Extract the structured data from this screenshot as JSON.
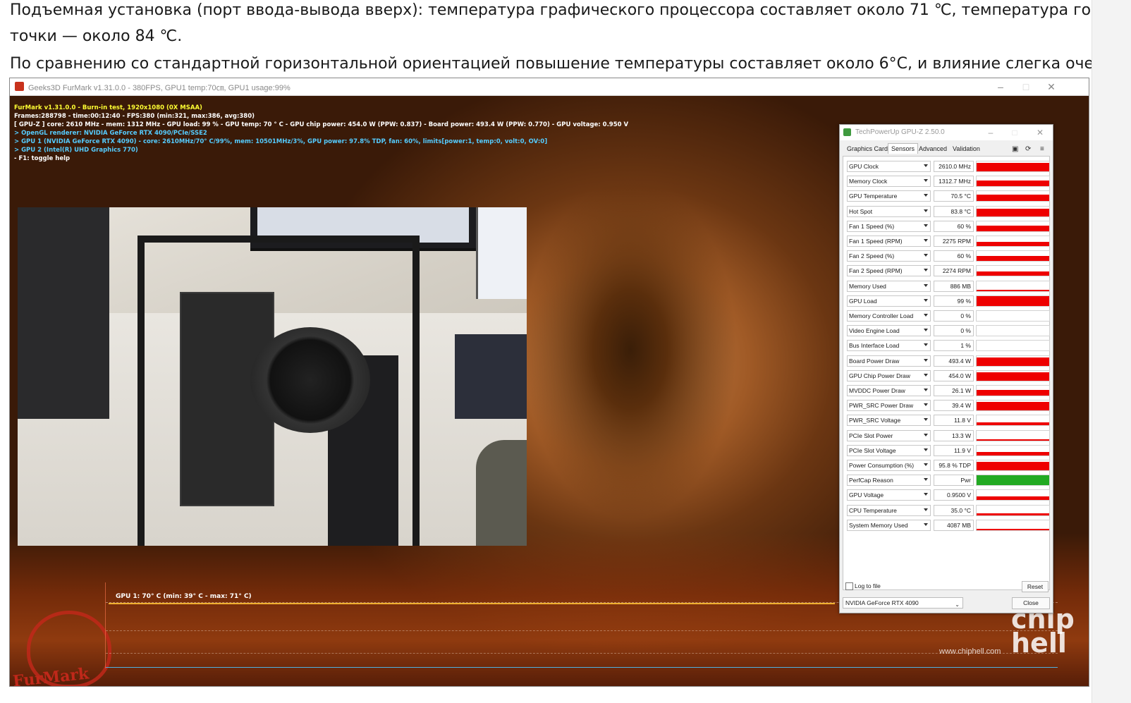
{
  "article": {
    "line1": "Подъемная установка (порт ввода-вывода вверх): температура графического процессора составляет около 71 ℃, температура горячей",
    "line2": "точки — около 84 ℃.",
    "line3": "По сравнению со стандартной горизонтальной ориентацией повышение температуры составляет около 6°C, и влияние слегка очевидно."
  },
  "furmark": {
    "window_title": "Geeks3D FurMark v1.31.0.0 - 380FPS, GPU1 temp:70㎝, GPU1 usage:99%",
    "overlay": [
      {
        "text": "FurMark v1.31.0.0 - Burn-in test, 1920x1080 (0X MSAA)",
        "color": "#ffff33"
      },
      {
        "text": "Frames:288798 - time:00:12:40 - FPS:380 (min:321, max:386, avg:380)",
        "color": "#ffffff"
      },
      {
        "text": "[ GPU-Z ] core: 2610 MHz - mem: 1312 MHz - GPU load: 99 % - GPU temp: 70 ° C - GPU chip power: 454.0 W (PPW: 0.837) - Board power: 493.4 W (PPW: 0.770) - GPU voltage: 0.950 V",
        "color": "#ffffff"
      },
      {
        "text": "> OpenGL renderer: NVIDIA GeForce RTX 4090/PCIe/SSE2",
        "color": "#55ccff"
      },
      {
        "text": "> GPU 1 (NVIDIA GeForce RTX 4090) - core: 2610MHz/70° C/99%, mem: 10501MHz/3%, GPU power: 97.8% TDP, fan: 60%, limits[power:1, temp:0, volt:0, OV:0]",
        "color": "#55ccff"
      },
      {
        "text": "> GPU 2 (Intel(R) UHD Graphics 770)",
        "color": "#55ccff"
      },
      {
        "text": "- F1: toggle help",
        "color": "#ffffff"
      }
    ],
    "graph_label": "GPU 1: 70° C (min: 39° C - max: 71° C)",
    "logo_text": "FurMark",
    "watermark_logo": "chip hell",
    "watermark_url": "www.chiphell.com",
    "colors": {
      "overlay_title": "#ffff33",
      "graph_line": "#f0b030",
      "graph_base": "#4fb0e0"
    }
  },
  "gpuz": {
    "title": "TechPowerUp GPU-Z 2.50.0",
    "tabs": [
      "Graphics Card",
      "Sensors",
      "Advanced",
      "Validation"
    ],
    "active_tab": "Sensors",
    "toolbar_icons": [
      "camera-icon",
      "refresh-icon",
      "menu-icon"
    ],
    "sensors": [
      {
        "name": "GPU Clock",
        "value": "2610.0 MHz",
        "level": 0.85,
        "graph": "red"
      },
      {
        "name": "Memory Clock",
        "value": "1312.7 MHz",
        "level": 0.6,
        "graph": "red"
      },
      {
        "name": "GPU Temperature",
        "value": "70.5 °C",
        "level": 0.7,
        "graph": "red"
      },
      {
        "name": "Hot Spot",
        "value": "83.8 °C",
        "level": 0.75,
        "graph": "red"
      },
      {
        "name": "Fan 1 Speed (%)",
        "value": "60 %",
        "level": 0.55,
        "graph": "red"
      },
      {
        "name": "Fan 1 Speed (RPM)",
        "value": "2275 RPM",
        "level": 0.45,
        "graph": "red"
      },
      {
        "name": "Fan 2 Speed (%)",
        "value": "60 %",
        "level": 0.55,
        "graph": "red"
      },
      {
        "name": "Fan 2 Speed (RPM)",
        "value": "2274 RPM",
        "level": 0.45,
        "graph": "red"
      },
      {
        "name": "Memory Used",
        "value": "886 MB",
        "level": 0.08,
        "graph": "red"
      },
      {
        "name": "GPU Load",
        "value": "99 %",
        "level": 0.99,
        "graph": "red"
      },
      {
        "name": "Memory Controller Load",
        "value": "0 %",
        "level": 0,
        "graph": "red"
      },
      {
        "name": "Video Engine Load",
        "value": "0 %",
        "level": 0,
        "graph": "red"
      },
      {
        "name": "Bus Interface Load",
        "value": "1 %",
        "level": 0,
        "graph": "red"
      },
      {
        "name": "Board Power Draw",
        "value": "493.4 W",
        "level": 0.85,
        "graph": "red"
      },
      {
        "name": "GPU Chip Power Draw",
        "value": "454.0 W",
        "level": 0.85,
        "graph": "red"
      },
      {
        "name": "MVDDC Power Draw",
        "value": "26.1 W",
        "level": 0.6,
        "graph": "red"
      },
      {
        "name": "PWR_SRC Power Draw",
        "value": "39.4 W",
        "level": 0.85,
        "graph": "red"
      },
      {
        "name": "PWR_SRC Voltage",
        "value": "11.8 V",
        "level": 0.35,
        "graph": "red"
      },
      {
        "name": "PCIe Slot Power",
        "value": "13.3 W",
        "level": 0.15,
        "graph": "red"
      },
      {
        "name": "PCIe Slot Voltage",
        "value": "11.9 V",
        "level": 0.35,
        "graph": "red"
      },
      {
        "name": "Power Consumption (%)",
        "value": "95.8 % TDP",
        "level": 0.85,
        "graph": "red"
      },
      {
        "name": "PerfCap Reason",
        "value": "Pwr",
        "level": 1,
        "graph": "green"
      },
      {
        "name": "GPU Voltage",
        "value": "0.9500 V",
        "level": 0.4,
        "graph": "red"
      },
      {
        "name": "CPU Temperature",
        "value": "35.0 °C",
        "level": 0.2,
        "graph": "red"
      },
      {
        "name": "System Memory Used",
        "value": "4087 MB",
        "level": 0.15,
        "graph": "red"
      }
    ],
    "log_to_file_label": "Log to file",
    "log_to_file_checked": false,
    "reset_label": "Reset",
    "device_selected": "NVIDIA GeForce RTX 4090",
    "close_label": "Close",
    "colors": {
      "graph_red": "#ee0000",
      "graph_green": "#22aa22"
    }
  }
}
